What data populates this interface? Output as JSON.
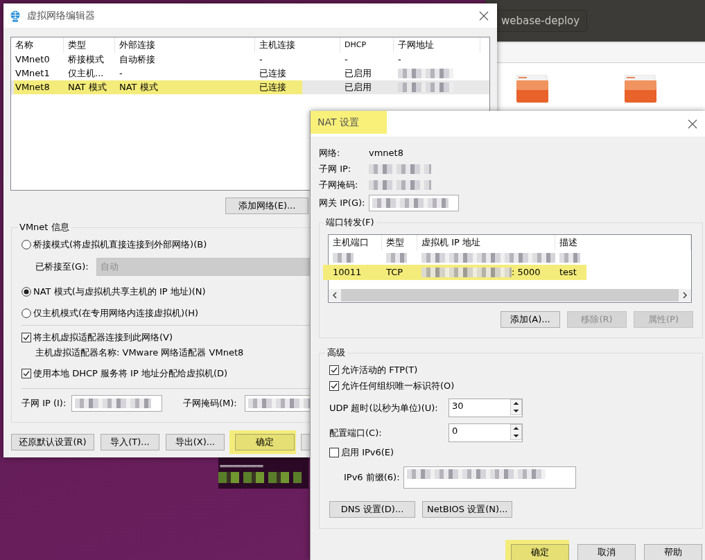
{
  "file_manager": {
    "path_button": "webase-deploy"
  },
  "terminal": {
    "line": "=============="
  },
  "network_editor": {
    "title": "虚拟网络编辑器",
    "table": {
      "columns": [
        "名称",
        "类型",
        "外部连接",
        "主机连接",
        "DHCP",
        "子网地址"
      ],
      "rows": [
        {
          "cells": [
            "VMnet0",
            "桥接模式",
            "自动桥接",
            "-",
            "-",
            "-"
          ],
          "selected": false,
          "highlighted": false
        },
        {
          "cells": [
            "VMnet1",
            "仅主机...",
            "-",
            "已连接",
            "已启用",
            {
              "kind": "redacted"
            }
          ],
          "selected": false,
          "highlighted": false
        },
        {
          "cells": [
            "VMnet8",
            "NAT 模式",
            "NAT 模式",
            "已连接",
            "已启用",
            {
              "kind": "redacted"
            }
          ],
          "selected": true,
          "highlighted": true
        }
      ]
    },
    "add_network_button": "添加网络(E)...",
    "vmnet_info": {
      "legend": "VMnet 信息",
      "modes": [
        {
          "label": "桥接模式(将虚拟机直接连接到外部网络)(B)",
          "selected": false
        },
        {
          "label": "NAT 模式(与虚拟机共享主机的 IP 地址)(N)",
          "selected": true
        },
        {
          "label": "仅主机模式(在专用网络内连接虚拟机)(H)",
          "selected": false
        }
      ],
      "bridged_to": {
        "label": "已桥接至(G):",
        "value": "自动",
        "disabled": true
      },
      "connect_adapter": {
        "label": "将主机虚拟适配器连接到此网络(V)",
        "checked": true
      },
      "adapter_name": "主机虚拟适配器名称: VMware 网络适配器 VMnet8",
      "use_dhcp": {
        "label": "使用本地 DHCP 服务将 IP 地址分配给虚拟机(D)",
        "checked": true
      },
      "subnet_ip": {
        "label": "子网 IP (I):",
        "redacted": true
      },
      "subnet_mask": {
        "label": "子网掩码(M):",
        "redacted": true
      }
    },
    "buttons": [
      {
        "label": "还原默认设置(R)",
        "highlighted": false
      },
      {
        "label": "导入(T)...",
        "highlighted": false
      },
      {
        "label": "导出(X)...",
        "highlighted": false
      },
      {
        "label": "确定",
        "highlighted": true
      },
      {
        "highlighted": false
      }
    ]
  },
  "nat_settings": {
    "title": "NAT 设置",
    "title_highlighted": true,
    "info": [
      {
        "label": "网络:",
        "value": "vmnet8"
      },
      {
        "label": "子网 IP:",
        "redacted": true
      },
      {
        "label": "子网掩码:",
        "redacted": true
      }
    ],
    "gateway": {
      "label": "网关 IP(G):",
      "redacted": true
    },
    "port_forwarding": {
      "legend": "端口转发(F)",
      "columns": [
        "主机端口",
        "类型",
        "虚拟机 IP 地址",
        "描述"
      ],
      "rows": [
        {
          "cells": [
            {
              "kind": "redacted"
            },
            {
              "kind": "redacted"
            },
            {
              "kind": "redacted"
            },
            {
              "kind": "redacted"
            }
          ],
          "highlighted": false
        },
        {
          "cells": [
            "10011",
            "TCP",
            {
              "kind": "redacted",
              "text": ": 5000"
            },
            "test"
          ],
          "highlighted": true
        }
      ],
      "buttons": [
        {
          "label": "添加(A)...",
          "disabled": false
        },
        {
          "label": "移除(R)",
          "disabled": true
        },
        {
          "label": "属性(P)",
          "disabled": true
        }
      ]
    },
    "advanced": {
      "legend": "高级",
      "options": [
        {
          "label": "允许活动的 FTP(T)",
          "checked": true
        },
        {
          "label": "允许任何组织唯一标识符(O)",
          "checked": true
        }
      ],
      "udp_timeout": {
        "label": "UDP 超时(以秒为单位)(U):",
        "value": "30"
      },
      "config_port": {
        "label": "配置端口(C):",
        "value": "0"
      },
      "enable_ipv6": {
        "label": "启用 IPv6(E)",
        "checked": false
      },
      "ipv6_prefix": {
        "label": "IPv6 前缀(6):",
        "redacted": true
      },
      "buttons": [
        "DNS 设置(D)...",
        "NetBIOS 设置(N)..."
      ]
    },
    "buttons": [
      {
        "label": "确定",
        "highlighted": true
      },
      {
        "label": "取消",
        "highlighted": false
      },
      {
        "label": "帮助",
        "highlighted": false
      }
    ]
  }
}
